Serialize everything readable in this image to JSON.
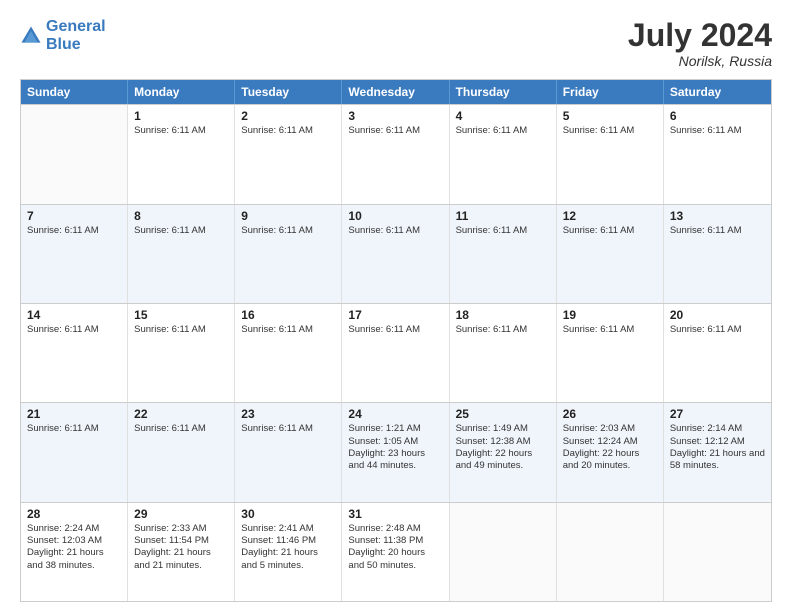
{
  "logo": {
    "line1": "General",
    "line2": "Blue"
  },
  "title": "July 2024",
  "location": "Norilsk, Russia",
  "header_days": [
    "Sunday",
    "Monday",
    "Tuesday",
    "Wednesday",
    "Thursday",
    "Friday",
    "Saturday"
  ],
  "rows": [
    [
      {
        "day": "",
        "info": ""
      },
      {
        "day": "1",
        "info": "Sunrise: 6:11 AM"
      },
      {
        "day": "2",
        "info": "Sunrise: 6:11 AM"
      },
      {
        "day": "3",
        "info": "Sunrise: 6:11 AM"
      },
      {
        "day": "4",
        "info": "Sunrise: 6:11 AM"
      },
      {
        "day": "5",
        "info": "Sunrise: 6:11 AM"
      },
      {
        "day": "6",
        "info": "Sunrise: 6:11 AM"
      }
    ],
    [
      {
        "day": "7",
        "info": "Sunrise: 6:11 AM"
      },
      {
        "day": "8",
        "info": "Sunrise: 6:11 AM"
      },
      {
        "day": "9",
        "info": "Sunrise: 6:11 AM"
      },
      {
        "day": "10",
        "info": "Sunrise: 6:11 AM"
      },
      {
        "day": "11",
        "info": "Sunrise: 6:11 AM"
      },
      {
        "day": "12",
        "info": "Sunrise: 6:11 AM"
      },
      {
        "day": "13",
        "info": "Sunrise: 6:11 AM"
      }
    ],
    [
      {
        "day": "14",
        "info": "Sunrise: 6:11 AM"
      },
      {
        "day": "15",
        "info": "Sunrise: 6:11 AM"
      },
      {
        "day": "16",
        "info": "Sunrise: 6:11 AM"
      },
      {
        "day": "17",
        "info": "Sunrise: 6:11 AM"
      },
      {
        "day": "18",
        "info": "Sunrise: 6:11 AM"
      },
      {
        "day": "19",
        "info": "Sunrise: 6:11 AM"
      },
      {
        "day": "20",
        "info": "Sunrise: 6:11 AM"
      }
    ],
    [
      {
        "day": "21",
        "info": "Sunrise: 6:11 AM"
      },
      {
        "day": "22",
        "info": "Sunrise: 6:11 AM"
      },
      {
        "day": "23",
        "info": "Sunrise: 6:11 AM"
      },
      {
        "day": "24",
        "info": "Sunrise: 1:21 AM\nSunset: 1:05 AM\nDaylight: 23 hours and 44 minutes."
      },
      {
        "day": "25",
        "info": "Sunrise: 1:49 AM\nSunset: 12:38 AM\nDaylight: 22 hours and 49 minutes."
      },
      {
        "day": "26",
        "info": "Sunrise: 2:03 AM\nSunset: 12:24 AM\nDaylight: 22 hours and 20 minutes."
      },
      {
        "day": "27",
        "info": "Sunrise: 2:14 AM\nSunset: 12:12 AM\nDaylight: 21 hours and 58 minutes."
      }
    ],
    [
      {
        "day": "28",
        "info": "Sunrise: 2:24 AM\nSunset: 12:03 AM\nDaylight: 21 hours and 38 minutes."
      },
      {
        "day": "29",
        "info": "Sunrise: 2:33 AM\nSunset: 11:54 PM\nDaylight: 21 hours and 21 minutes."
      },
      {
        "day": "30",
        "info": "Sunrise: 2:41 AM\nSunset: 11:46 PM\nDaylight: 21 hours and 5 minutes."
      },
      {
        "day": "31",
        "info": "Sunrise: 2:48 AM\nSunset: 11:38 PM\nDaylight: 20 hours and 50 minutes."
      },
      {
        "day": "",
        "info": ""
      },
      {
        "day": "",
        "info": ""
      },
      {
        "day": "",
        "info": ""
      }
    ]
  ]
}
